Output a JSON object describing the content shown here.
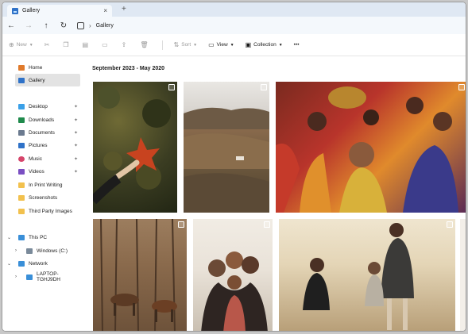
{
  "tab": {
    "title": "Gallery",
    "close": "×",
    "new_tab": "+"
  },
  "nav": {
    "back": "←",
    "forward": "→",
    "up": "↑",
    "refresh": "↻",
    "separator": "›",
    "location": "Gallery"
  },
  "toolbar": {
    "new_label": "New",
    "sort_label": "Sort",
    "view_label": "View",
    "collection_label": "Collection",
    "more_label": "•••"
  },
  "sidebar": {
    "items": [
      {
        "label": "Home",
        "icon": "home-icon",
        "color": "#e07a2b"
      },
      {
        "label": "Gallery",
        "icon": "gallery-icon",
        "color": "#2f72c8"
      },
      {
        "label": "Desktop",
        "icon": "desktop-icon",
        "color": "#3aa0e8"
      },
      {
        "label": "Downloads",
        "icon": "download-icon",
        "color": "#1f8a4c"
      },
      {
        "label": "Documents",
        "icon": "documents-icon",
        "color": "#6b7a8f"
      },
      {
        "label": "Pictures",
        "icon": "pictures-icon",
        "color": "#2f72c8"
      },
      {
        "label": "Music",
        "icon": "music-icon",
        "color": "#d6456b"
      },
      {
        "label": "Videos",
        "icon": "videos-icon",
        "color": "#7a4fc2"
      },
      {
        "label": "In Print Writing",
        "icon": "folder-icon",
        "color": "#f2c14e"
      },
      {
        "label": "Screenshots",
        "icon": "folder-icon",
        "color": "#f2c14e"
      },
      {
        "label": "Third Party Images",
        "icon": "folder-icon",
        "color": "#f2c14e"
      },
      {
        "label": "This PC",
        "icon": "pc-icon",
        "color": "#3a8fd8"
      },
      {
        "label": "Windows (C:)",
        "icon": "drive-icon",
        "color": "#7a8a9a"
      },
      {
        "label": "Network",
        "icon": "network-icon",
        "color": "#3a8fd8"
      },
      {
        "label": "LAPTOP-TGHJ9DH",
        "icon": "computer-icon",
        "color": "#3a8fd8"
      }
    ],
    "pin_glyph": "📌",
    "expand_glyph": "›",
    "collapse_glyph": "⌄"
  },
  "gallery": {
    "group_title": "September 2023 - May 2020",
    "photos": [
      {
        "name": "photo-autumn-leaf",
        "colors": [
          "#3b3d22",
          "#5b5a2c",
          "#2e311a"
        ],
        "accent": "#c8431f"
      },
      {
        "name": "photo-highland-hills",
        "colors": [
          "#e7e4df",
          "#8b6b4d",
          "#4d3f2d"
        ],
        "accent": "#6f5a3f"
      },
      {
        "name": "photo-festival-dance",
        "colors": [
          "#b8342b",
          "#e08a2c",
          "#5a2a55"
        ],
        "accent": "#f0b638"
      },
      {
        "name": "photo-horses-forest",
        "colors": [
          "#8a6a4c",
          "#6d523a",
          "#3d2b1e"
        ],
        "accent": "#5b3a24"
      },
      {
        "name": "photo-family-selfie",
        "colors": [
          "#e9e2d8",
          "#6b4a36",
          "#2e2522"
        ],
        "accent": "#b8574a"
      },
      {
        "name": "photo-family-field",
        "colors": [
          "#e4d5b6",
          "#b79e77",
          "#8f7a5c"
        ],
        "accent": "#3b3a38"
      }
    ]
  }
}
